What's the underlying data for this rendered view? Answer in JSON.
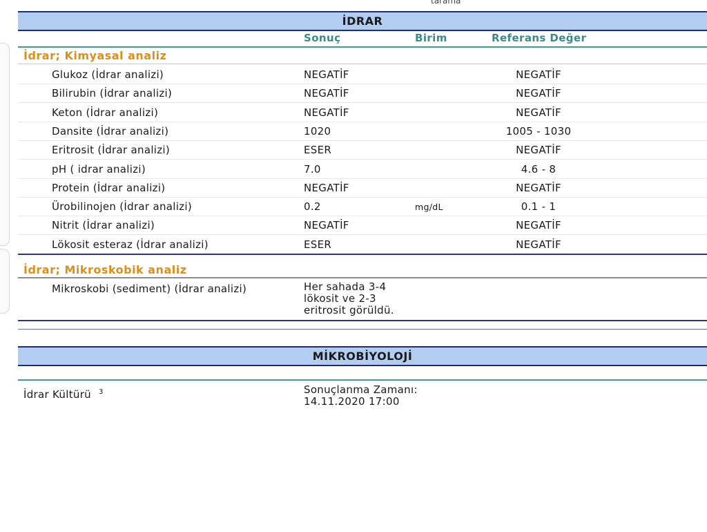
{
  "top_cut_text": "tarama",
  "idrar": {
    "title": "İDRAR",
    "columns": {
      "result": "Sonuç",
      "unit": "Birim",
      "ref": "Referans Değer"
    },
    "chem_title": "İdrar; Kimyasal analiz",
    "chem_rows": [
      {
        "name": "Glukoz (İdrar analizi)",
        "result": "NEGATİF",
        "unit": "",
        "ref": "NEGATİF"
      },
      {
        "name": "Bilirubin (İdrar analizi)",
        "result": "NEGATİF",
        "unit": "",
        "ref": "NEGATİF"
      },
      {
        "name": "Keton (İdrar analizi)",
        "result": "NEGATİF",
        "unit": "",
        "ref": "NEGATİF"
      },
      {
        "name": "Dansite (İdrar analizi)",
        "result": "1020",
        "unit": "",
        "ref": "1005 - 1030"
      },
      {
        "name": "Eritrosit (İdrar analizi)",
        "result": "ESER",
        "unit": "",
        "ref": "NEGATİF"
      },
      {
        "name": "pH ( idrar analizi)",
        "result": "7.0",
        "unit": "",
        "ref": "4.6 - 8"
      },
      {
        "name": "Protein (İdrar analizi)",
        "result": "NEGATİF",
        "unit": "",
        "ref": "NEGATİF"
      },
      {
        "name": "Ürobilinojen (İdrar analizi)",
        "result": "0.2",
        "unit": "mg/dL",
        "ref": "0.1 - 1"
      },
      {
        "name": "Nitrit (İdrar analizi)",
        "result": "NEGATİF",
        "unit": "",
        "ref": "NEGATİF"
      },
      {
        "name": "Lökosit esteraz (İdrar analizi)",
        "result": "ESER",
        "unit": "",
        "ref": "NEGATİF"
      }
    ],
    "micro_title": "İdrar; Mikroskobik analiz",
    "micro_name": "Mikroskobi (sediment) (İdrar analizi)",
    "micro_result": [
      "Her sahada 3-4",
      "lökosit ve 2-3",
      "eritrosit görüldü."
    ]
  },
  "mikro": {
    "title": "MİKROBİYOLOJİ",
    "culture_name": "İdrar Kültürü",
    "culture_sup": "3",
    "result_label": "Sonuçlanma Zamanı:",
    "result_time": "14.11.2020 17:00"
  }
}
